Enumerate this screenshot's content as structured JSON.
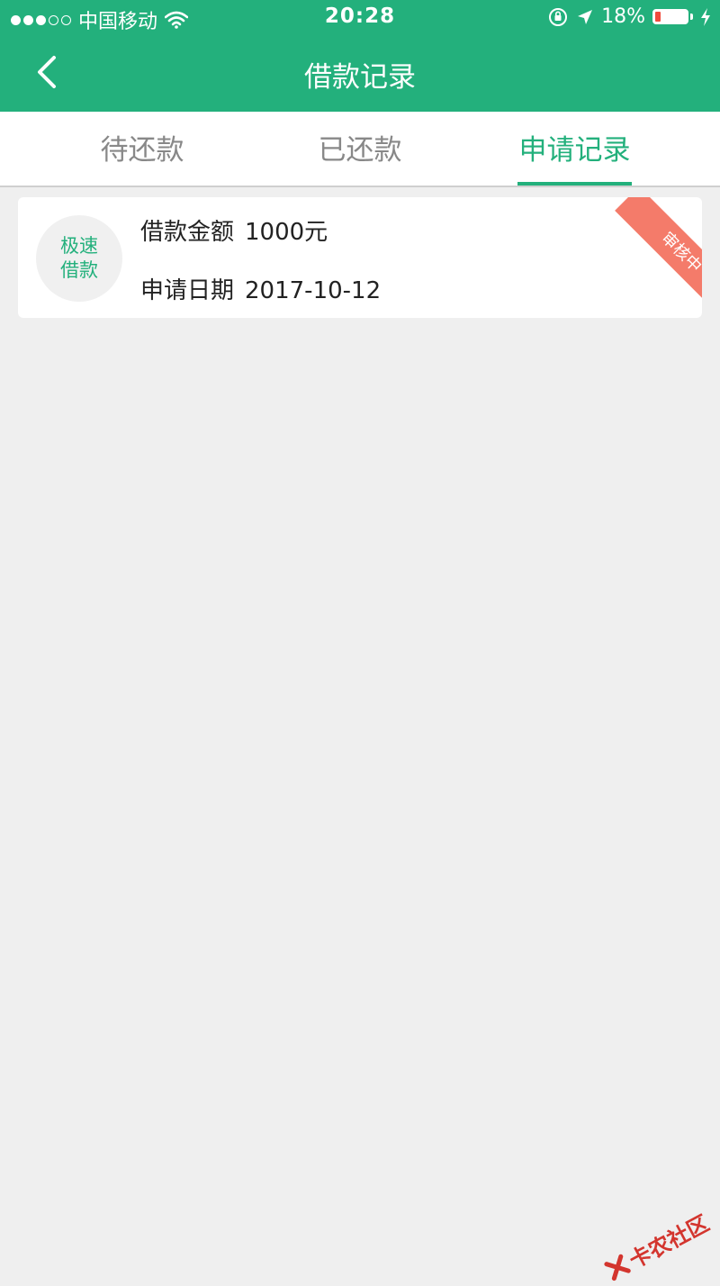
{
  "status_bar": {
    "carrier": "中国移动",
    "time": "20:28",
    "battery_percent": "18%",
    "battery_level": 0.18,
    "icons": [
      "signal-dots-icon",
      "wifi-icon",
      "rotation-lock-icon",
      "location-arrow-icon",
      "battery-icon",
      "charging-bolt-icon"
    ]
  },
  "nav": {
    "title": "借款记录",
    "back_icon": "chevron-left-icon"
  },
  "tabs": [
    {
      "label": "待还款",
      "active": false
    },
    {
      "label": "已还款",
      "active": false
    },
    {
      "label": "申请记录",
      "active": true
    }
  ],
  "record": {
    "badge_line1": "极速",
    "badge_line2": "借款",
    "amount_label": "借款金额",
    "amount_value": "1000元",
    "date_label": "申请日期",
    "date_value": "2017-10-12",
    "status": "审核中"
  },
  "watermark": {
    "text": "卡农社区"
  },
  "colors": {
    "primary": "#23b07c",
    "ribbon": "#f47b6a",
    "background": "#efefef",
    "battery_low": "#f04b3c"
  }
}
